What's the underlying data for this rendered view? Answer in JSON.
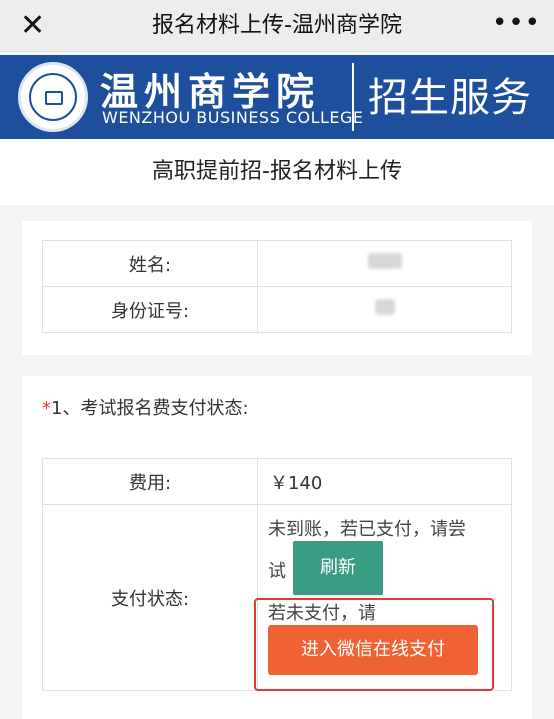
{
  "nav": {
    "close_icon": "close-icon",
    "title": "报名材料上传-温州商学院",
    "more_icon": "more-icon",
    "more_glyph": "•••"
  },
  "banner": {
    "school_cn": "温州商学院",
    "school_en": "WENZHOU BUSINESS COLLEGE",
    "service": "招生服务",
    "brand_color": "#1d4f9c"
  },
  "page": {
    "heading": "高职提前招-报名材料上传"
  },
  "personal": {
    "name_label": "姓名:",
    "id_label": "身份证号:"
  },
  "payment": {
    "star": "*",
    "section_title": "1、考试报名费支付状态:",
    "fee_label": "费用:",
    "fee_value": "￥140",
    "status_label": "支付状态:",
    "status_line1": "未到账，若已支付，请尝",
    "status_line2": "试",
    "refresh_label": "刷新",
    "status_line3": "若未支付，请",
    "pay_label": "进入微信在线支付",
    "refresh_color": "#3a9c82",
    "pay_color": "#ee6233"
  }
}
